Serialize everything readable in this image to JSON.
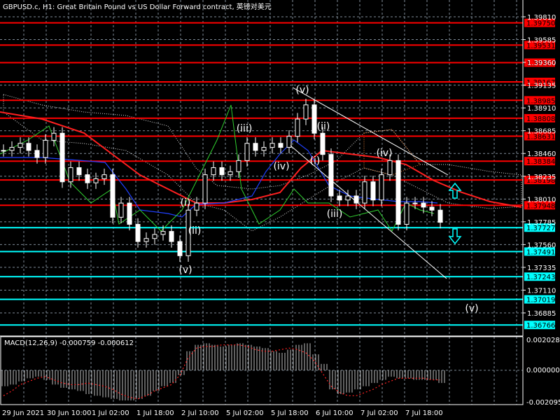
{
  "header": {
    "title": "GBPUSD.c, H1:  Great Britain Pound vs US Dollar Forward contract, 英镑对美元"
  },
  "macd": {
    "label": "MACD(12,26,9) -0.000759 -0.000612",
    "axis": [
      "0.002028",
      "0.000000",
      "-0.002095"
    ]
  },
  "colors": {
    "bg": "#000000",
    "grid": "#7f8c99",
    "support": "#00ffff",
    "resistance": "#ff0000",
    "ma_red": "#ff2020",
    "ma_blue": "#2040ff",
    "wave": "#ffffff"
  },
  "chart_data": {
    "type": "candlestick",
    "symbol": "GBPUSD.c",
    "timeframe": "H1",
    "ylim": [
      1.3666,
      1.40035
    ],
    "y_ticks": [
      "1.39810",
      "1.39585",
      "1.39360",
      "1.39135",
      "1.38910",
      "1.38685",
      "1.38460",
      "1.38235",
      "1.38010",
      "1.37785",
      "1.37560",
      "1.37335",
      "1.37110",
      "1.36885"
    ],
    "x_ticks": [
      "29 Jun 2021",
      "30 Jun 10:00",
      "1 Jul 02:00",
      "1 Jul 18:00",
      "2 Jul 10:00",
      "5 Jul 02:00",
      "5 Jul 18:00",
      "6 Jul 10:00",
      "7 Jul 02:00",
      "7 Jul 18:00"
    ],
    "close": [
      1.3849,
      1.3852,
      1.3856,
      1.3849,
      1.3842,
      1.3859,
      1.3866,
      1.3818,
      1.3832,
      1.3825,
      1.3817,
      1.3821,
      1.3825,
      1.3783,
      1.3797,
      1.3776,
      1.3759,
      1.3762,
      1.3766,
      1.3769,
      1.3759,
      1.3745,
      1.379,
      1.3797,
      1.3825,
      1.3832,
      1.3825,
      1.3828,
      1.3839,
      1.3856,
      1.3849,
      1.3852,
      1.3856,
      1.3852,
      1.3863,
      1.388,
      1.3894,
      1.3866,
      1.3845,
      1.3804,
      1.38,
      1.3804,
      1.3797,
      1.3818,
      1.38,
      1.3825,
      1.3839,
      1.3776,
      1.3797,
      1.3797,
      1.3793,
      1.379,
      1.3778
    ],
    "resistance_levels": [
      "1.39750",
      "1.39531",
      "1.39357",
      "1.39167",
      "1.38985",
      "1.38808",
      "1.38631",
      "1.38384",
      "1.38198",
      "1.37948"
    ],
    "support_levels": [
      "1.37727",
      "1.37491",
      "1.37243",
      "1.37019",
      "1.36766"
    ],
    "wave_labels": [
      "(v)",
      "(iii)",
      "(iv)",
      "(ii)",
      "(i)",
      "(i)",
      "(ii)",
      "(v)",
      "(iii)",
      "(iv)",
      "(v)"
    ],
    "macd_hist": [
      -0.001,
      -0.0009,
      -0.0007,
      -0.0005,
      -0.0004,
      -0.0006,
      -0.0009,
      -0.0011,
      -0.0012,
      -0.0013,
      -0.0015,
      -0.0016,
      -0.0017,
      -0.0018,
      -0.0019,
      -0.0019,
      -0.0018,
      -0.0016,
      -0.0013,
      -0.001,
      -0.0008,
      -0.0003,
      0.0012,
      0.0016,
      0.0017,
      0.0016,
      0.0015,
      0.0016,
      0.0017,
      0.0016,
      0.0015,
      0.0014,
      0.0012,
      0.0011,
      0.0013,
      0.0016,
      0.0017,
      0.001,
      0.0004,
      -0.0012,
      -0.0015,
      -0.0014,
      -0.0012,
      -0.001,
      -0.0008,
      -0.0006,
      -0.0004,
      -0.0005,
      -0.0005,
      -0.0006,
      -0.0006,
      -0.0006,
      -0.0008
    ],
    "macd_signal": [
      -0.0016,
      -0.0013,
      -0.0009,
      -0.0007,
      -0.0005,
      -0.0004,
      -0.0006,
      -0.0008,
      -0.0009,
      -0.0009,
      -0.0008,
      -0.0009,
      -0.001,
      -0.0012,
      -0.0015,
      -0.0017,
      -0.0018,
      -0.0016,
      -0.0013,
      -0.0011,
      -0.0009,
      -0.0003,
      0.0008,
      0.0014,
      0.0015,
      0.0015,
      0.0016,
      0.0016,
      0.0016,
      0.0015,
      0.0013,
      0.0012,
      0.0012,
      0.0013,
      0.0014,
      0.0013,
      0.0011,
      0.0006,
      -0.0002,
      -0.001,
      -0.0014,
      -0.0016,
      -0.0016,
      -0.0014,
      -0.0012,
      -0.0009,
      -0.0007,
      -0.0005,
      -0.0005,
      -0.0005,
      -0.0005,
      -0.0006,
      -0.0006
    ],
    "macd_ylim": [
      -0.002095,
      0.002028
    ]
  }
}
